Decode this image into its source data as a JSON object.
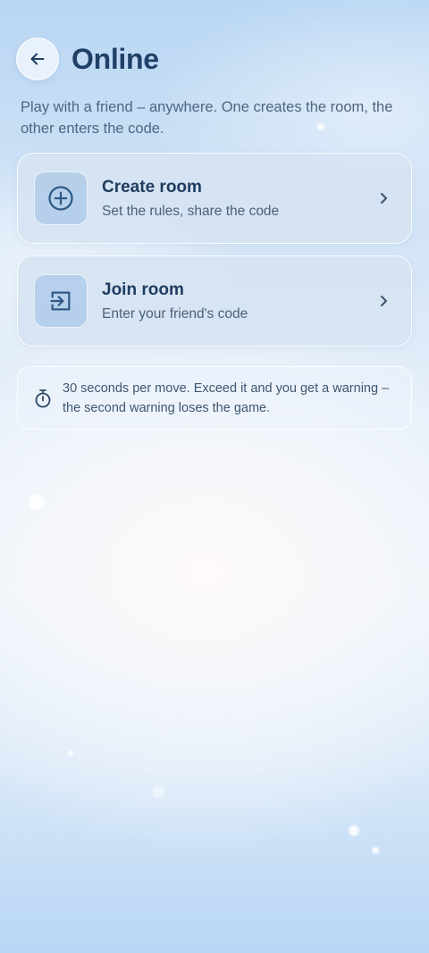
{
  "header": {
    "back_icon": "arrow-left-icon",
    "title": "Online"
  },
  "subtitle": "Play with a friend – anywhere. One creates the room, the other enters the code.",
  "cards": [
    {
      "icon": "plus-circle-icon",
      "title": "Create room",
      "description": "Set the rules, share the code",
      "chevron": "chevron-right-icon"
    },
    {
      "icon": "login-arrow-icon",
      "title": "Join room",
      "description": "Enter your friend's code",
      "chevron": "chevron-right-icon"
    }
  ],
  "info": {
    "icon": "stopwatch-icon",
    "text": "30 seconds per move. Exceed it and you get a warning – the second warning loses the game."
  },
  "colors": {
    "title": "#1f4068",
    "card_bg": "#d6e3f1",
    "icon_box": "#b0cce9",
    "icon_stroke": "#2f5a85"
  }
}
